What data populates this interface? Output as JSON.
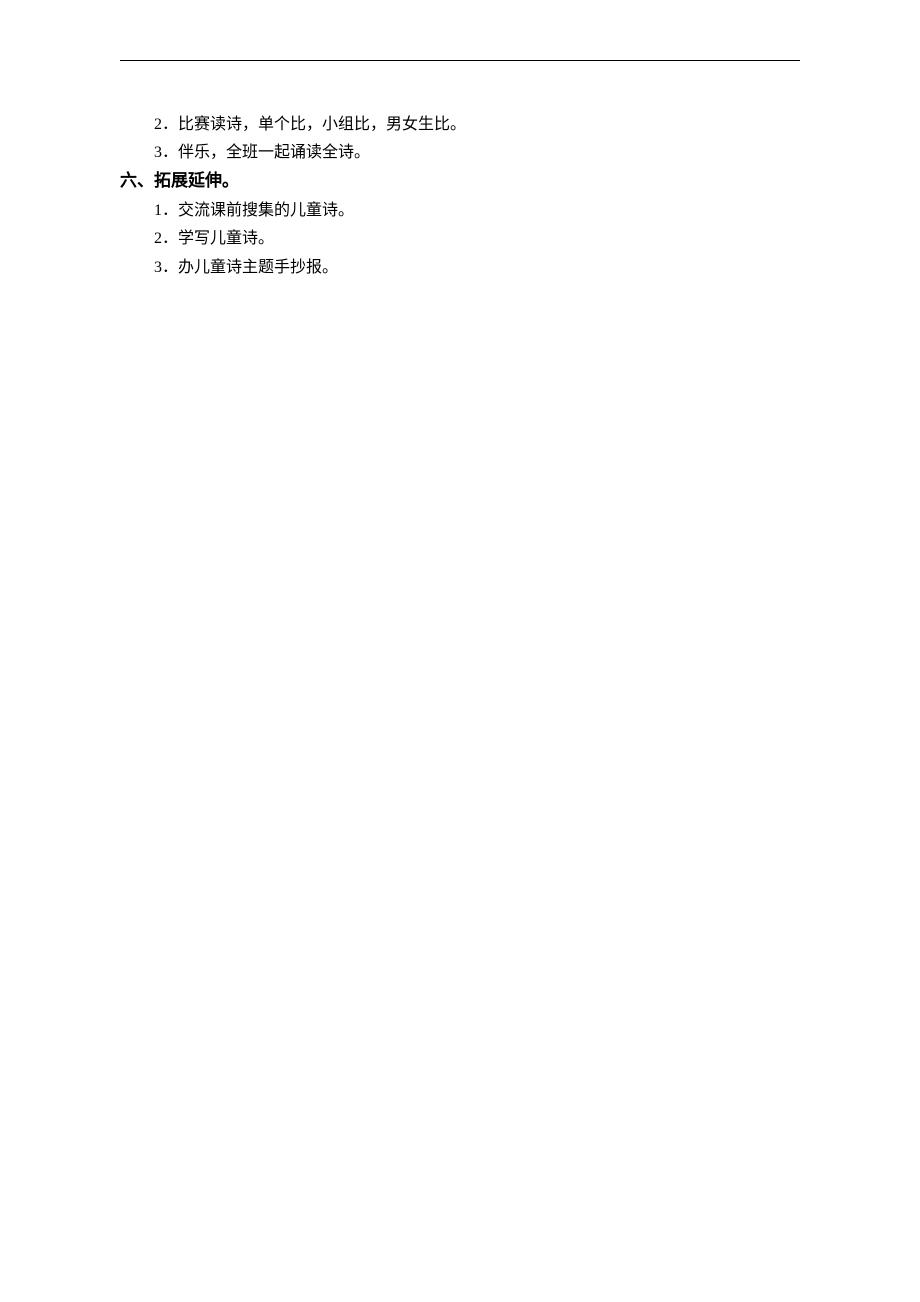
{
  "lines": {
    "l1": "2．比赛读诗，单个比，小组比，男女生比。",
    "l2": "3．伴乐，全班一起诵读全诗。",
    "heading": "六、拓展延伸。",
    "l3": "1．交流课前搜集的儿童诗。",
    "l4": "2．学写儿童诗。",
    "l5": "3．办儿童诗主题手抄报。"
  }
}
